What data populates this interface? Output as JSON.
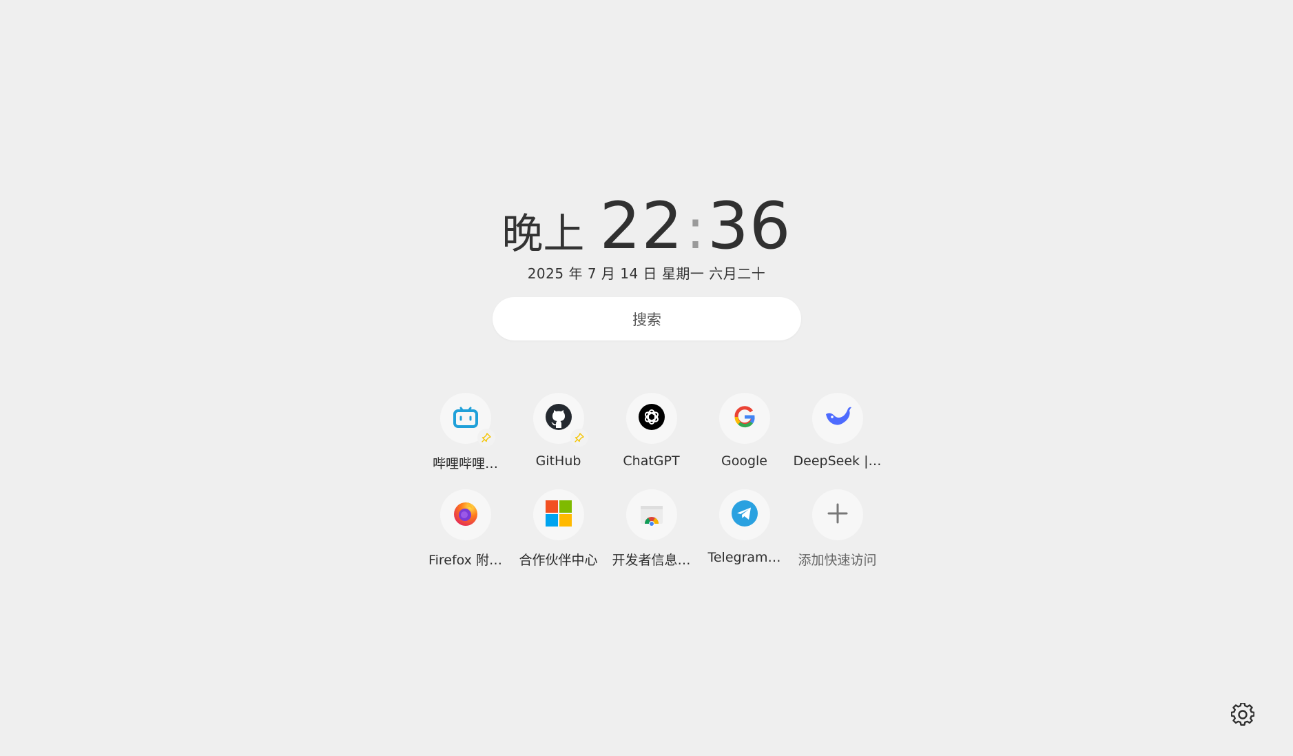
{
  "clock": {
    "period": "晚上",
    "hours": "22",
    "separator": ":",
    "minutes": "36"
  },
  "date_text": "2025 年 7 月 14 日 星期一 六月二十",
  "search": {
    "placeholder": "搜索"
  },
  "shortcuts": [
    {
      "label": "哔哩哔哩…",
      "icon": "bilibili-icon",
      "pinned": true
    },
    {
      "label": "GitHub",
      "icon": "github-icon",
      "pinned": true
    },
    {
      "label": "ChatGPT",
      "icon": "chatgpt-icon",
      "pinned": false
    },
    {
      "label": "Google",
      "icon": "google-icon",
      "pinned": false
    },
    {
      "label": "DeepSeek |…",
      "icon": "deepseek-icon",
      "pinned": false
    },
    {
      "label": "Firefox 附…",
      "icon": "firefox-icon",
      "pinned": false
    },
    {
      "label": "合作伙伴中心",
      "icon": "microsoft-icon",
      "pinned": false
    },
    {
      "label": "开发者信息…",
      "icon": "chrome-webstore-icon",
      "pinned": false
    },
    {
      "label": "Telegram…",
      "icon": "telegram-icon",
      "pinned": false
    },
    {
      "label": "添加快速访问",
      "icon": "plus-icon",
      "pinned": false
    }
  ],
  "colors": {
    "background": "#efefef",
    "bilibili": "#1fa0d9",
    "pin": "#f5c400",
    "telegram": "#2aa1e0",
    "deepseek": "#4d6bfe"
  }
}
